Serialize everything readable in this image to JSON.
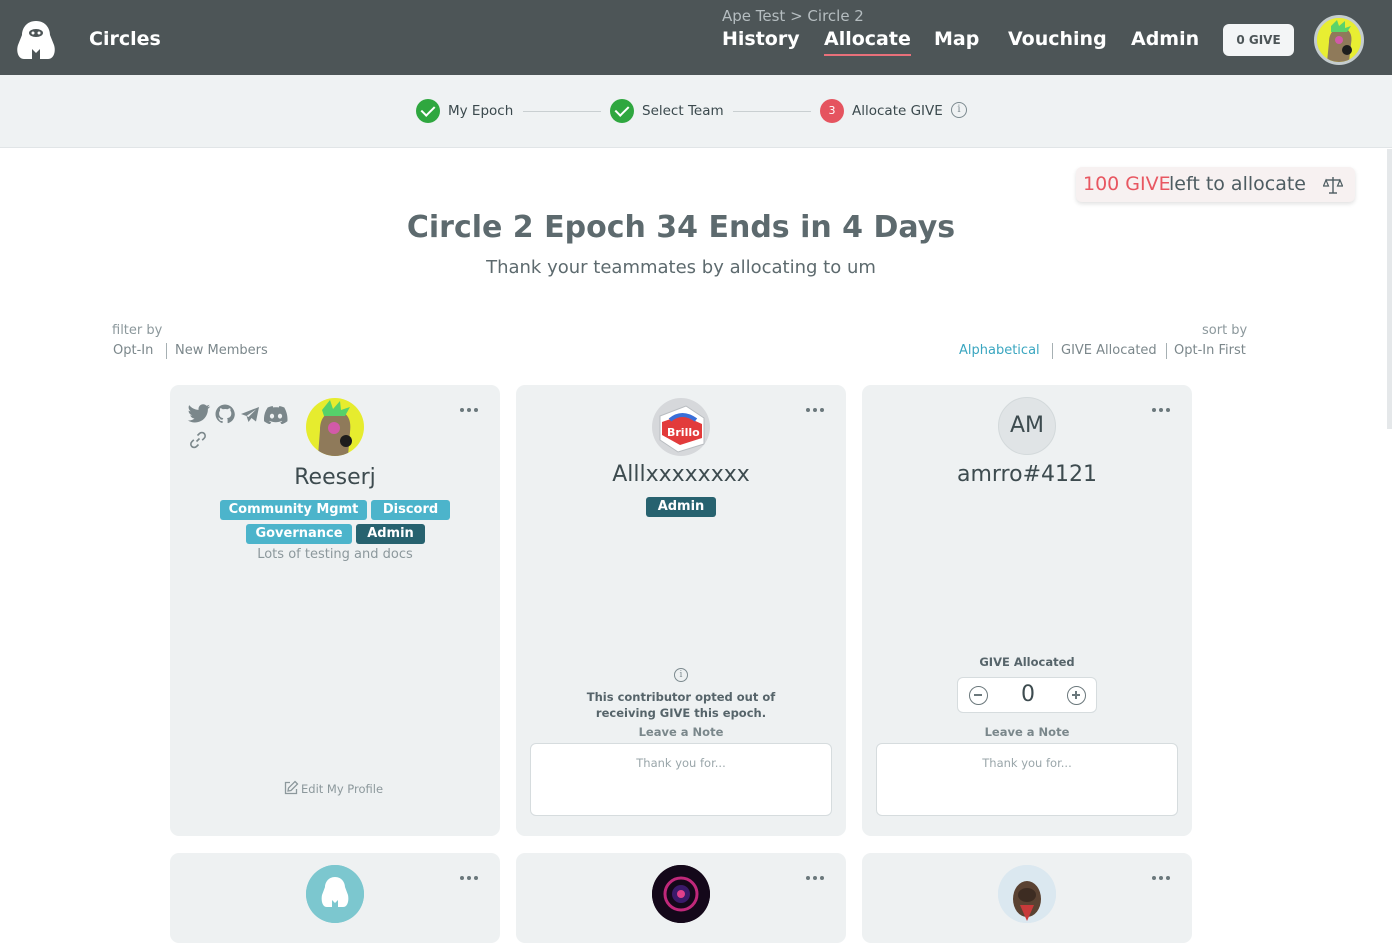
{
  "header": {
    "brand": "Circles",
    "breadcrumb": "Ape Test > Circle 2",
    "nav": [
      "History",
      "Allocate",
      "Map",
      "Vouching",
      "Admin"
    ],
    "active_nav": "Allocate",
    "give_button": "0 GIVE",
    "accent_color": "#e9707a"
  },
  "stepper": {
    "steps": [
      {
        "label": "My Epoch",
        "status": "done"
      },
      {
        "label": "Select Team",
        "status": "done"
      },
      {
        "label": "Allocate GIVE",
        "status": "current",
        "number": "3"
      }
    ]
  },
  "give_remaining": {
    "amount": "100 GIVE",
    "text": "left to allocate"
  },
  "title": "Circle 2 Epoch 34 Ends in 4 Days",
  "subtitle": "Thank your teammates by allocating to um",
  "filter": {
    "label": "filter by",
    "options": [
      "Opt-In",
      "New Members"
    ]
  },
  "sort": {
    "label": "sort by",
    "options": [
      "Alphabetical",
      "GIVE Allocated",
      "Opt-In First"
    ],
    "active": "Alphabetical"
  },
  "cards": [
    {
      "name": "Reeserj",
      "tags": [
        "Community Mgmt",
        "Discord",
        "Governance",
        "Admin"
      ],
      "bio": "Lots of testing and docs",
      "edit_profile": "Edit My Profile",
      "social_icons": [
        "twitter-icon",
        "github-icon",
        "telegram-icon",
        "discord-icon",
        "link-icon"
      ]
    },
    {
      "name": "Alllxxxxxxxx",
      "tags": [
        "Admin"
      ],
      "opt_out_text": "This contributor opted out of receiving GIVE this epoch.",
      "note_label": "Leave a Note",
      "note_placeholder": "Thank you for..."
    },
    {
      "name": "amrro#4121",
      "initials": "AM",
      "give_label": "GIVE Allocated",
      "give_value": "0",
      "note_label": "Leave a Note",
      "note_placeholder": "Thank you for..."
    }
  ]
}
